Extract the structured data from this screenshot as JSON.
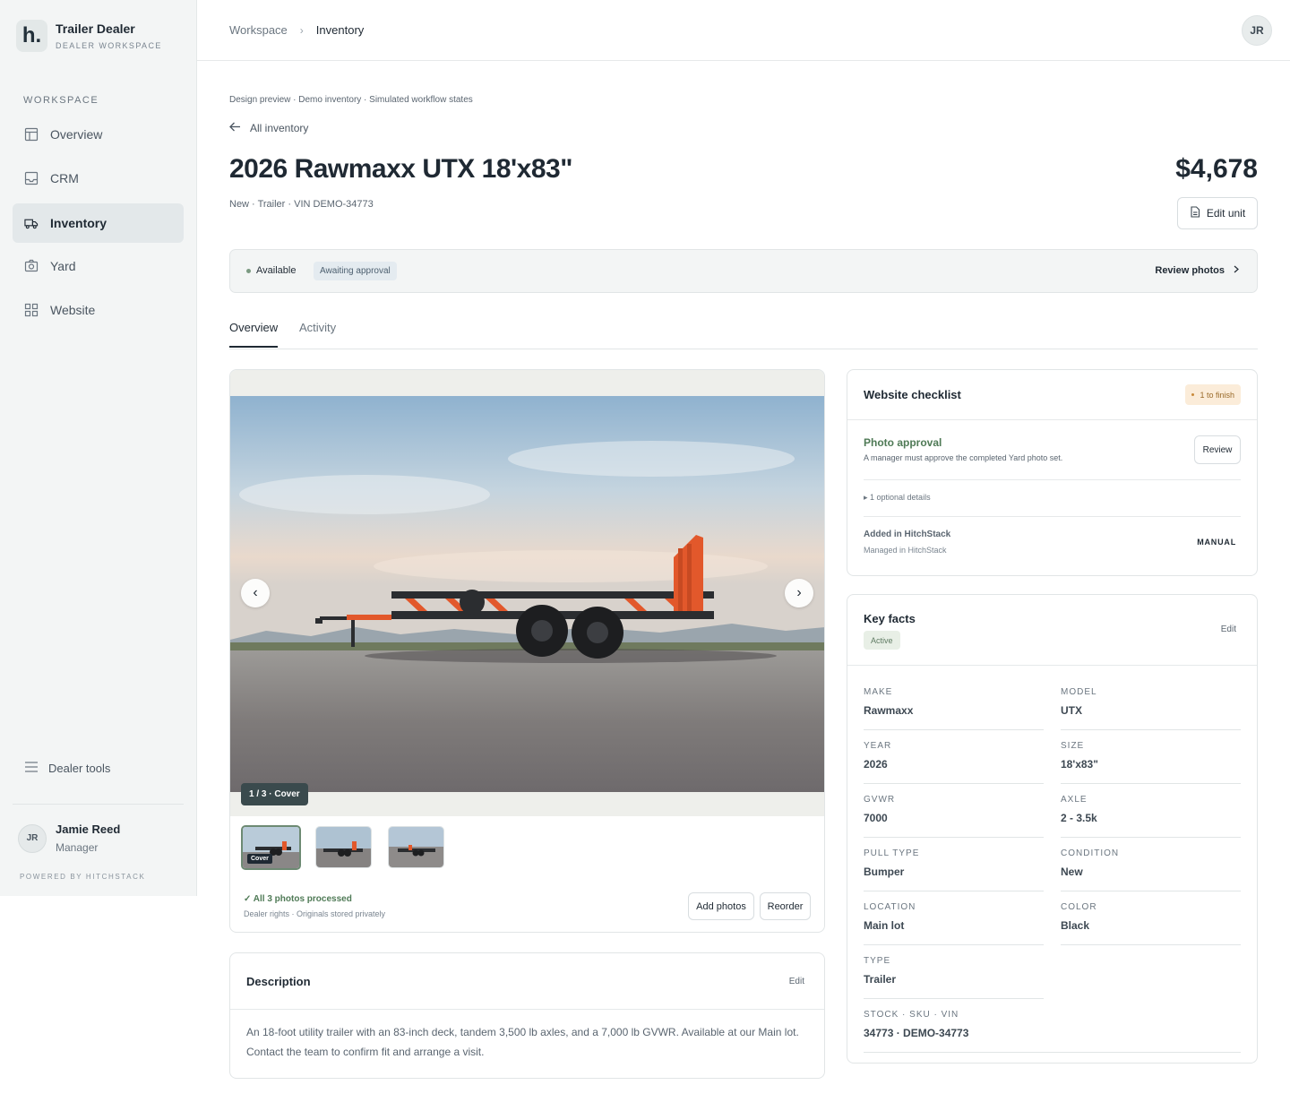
{
  "sidebar": {
    "brand_logo": "h.",
    "brand_name": "Trailer Dealer",
    "brand_sub": "DEALER WORKSPACE",
    "section_label": "WORKSPACE",
    "items": [
      {
        "label": "Overview",
        "icon": "layout-icon"
      },
      {
        "label": "CRM",
        "icon": "inbox-icon"
      },
      {
        "label": "Inventory",
        "icon": "truck-icon",
        "active": true
      },
      {
        "label": "Yard",
        "icon": "camera-icon"
      },
      {
        "label": "Website",
        "icon": "grid-icon"
      }
    ],
    "dealer_tools": "Dealer tools",
    "user": {
      "initials": "JR",
      "name": "Jamie Reed",
      "role": "Manager"
    },
    "powered_by": "POWERED BY HITCHSTACK"
  },
  "topbar": {
    "breadcrumb": [
      "Workspace",
      "Inventory"
    ],
    "breadcrumb_sep": "›",
    "avatar": "JR"
  },
  "header": {
    "preview_note": "Design preview · Demo inventory · Simulated workflow states",
    "back_label": "All inventory",
    "title": "2026 Rawmaxx UTX 18'x83\"",
    "subtitle": "New · Trailer · VIN DEMO-34773",
    "price": "$4,678",
    "edit_unit": "Edit unit"
  },
  "status": {
    "availability": "Available",
    "approval": "Awaiting approval",
    "review_photos": "Review photos"
  },
  "tabs": [
    {
      "label": "Overview",
      "active": true
    },
    {
      "label": "Activity",
      "active": false
    }
  ],
  "gallery": {
    "counter": "1 / 3 · Cover",
    "cover_tag": "Cover",
    "processed": "✓ All 3 photos processed",
    "rights": "Dealer rights · Originals stored privately",
    "add_photos": "Add photos",
    "reorder": "Reorder"
  },
  "description": {
    "title": "Description",
    "edit": "Edit",
    "body": "An 18-foot utility trailer with an 83-inch deck, tandem 3,500 lb axles, and a 7,000 lb GVWR. Available at our Main lot. Contact the team to confirm fit and arrange a visit."
  },
  "checklist": {
    "title": "Website checklist",
    "badge": "1 to finish",
    "item_title": "Photo approval",
    "item_desc": "A manager must approve the completed Yard photo set.",
    "review": "Review",
    "optional": "▸ 1 optional details",
    "added_title": "Added in HitchStack",
    "added_sub": "Managed in HitchStack",
    "source": "MANUAL"
  },
  "key_facts": {
    "title": "Key facts",
    "status": "Active",
    "edit": "Edit",
    "facts": [
      {
        "label": "MAKE",
        "value": "Rawmaxx"
      },
      {
        "label": "MODEL",
        "value": "UTX"
      },
      {
        "label": "YEAR",
        "value": "2026"
      },
      {
        "label": "SIZE",
        "value": "18'x83\""
      },
      {
        "label": "GVWR",
        "value": "7000"
      },
      {
        "label": "AXLE",
        "value": "2 - 3.5k"
      },
      {
        "label": "PULL TYPE",
        "value": "Bumper"
      },
      {
        "label": "CONDITION",
        "value": "New"
      },
      {
        "label": "LOCATION",
        "value": "Main lot"
      },
      {
        "label": "COLOR",
        "value": "Black"
      },
      {
        "label": "TYPE",
        "value": "Trailer"
      },
      {
        "label": "STOCK · SKU · VIN",
        "value": "34773 · DEMO-34773"
      }
    ]
  },
  "colors": {
    "accent_green": "#4f7a56",
    "trailer_orange": "#e2582b",
    "text_dark": "#1f2933"
  }
}
